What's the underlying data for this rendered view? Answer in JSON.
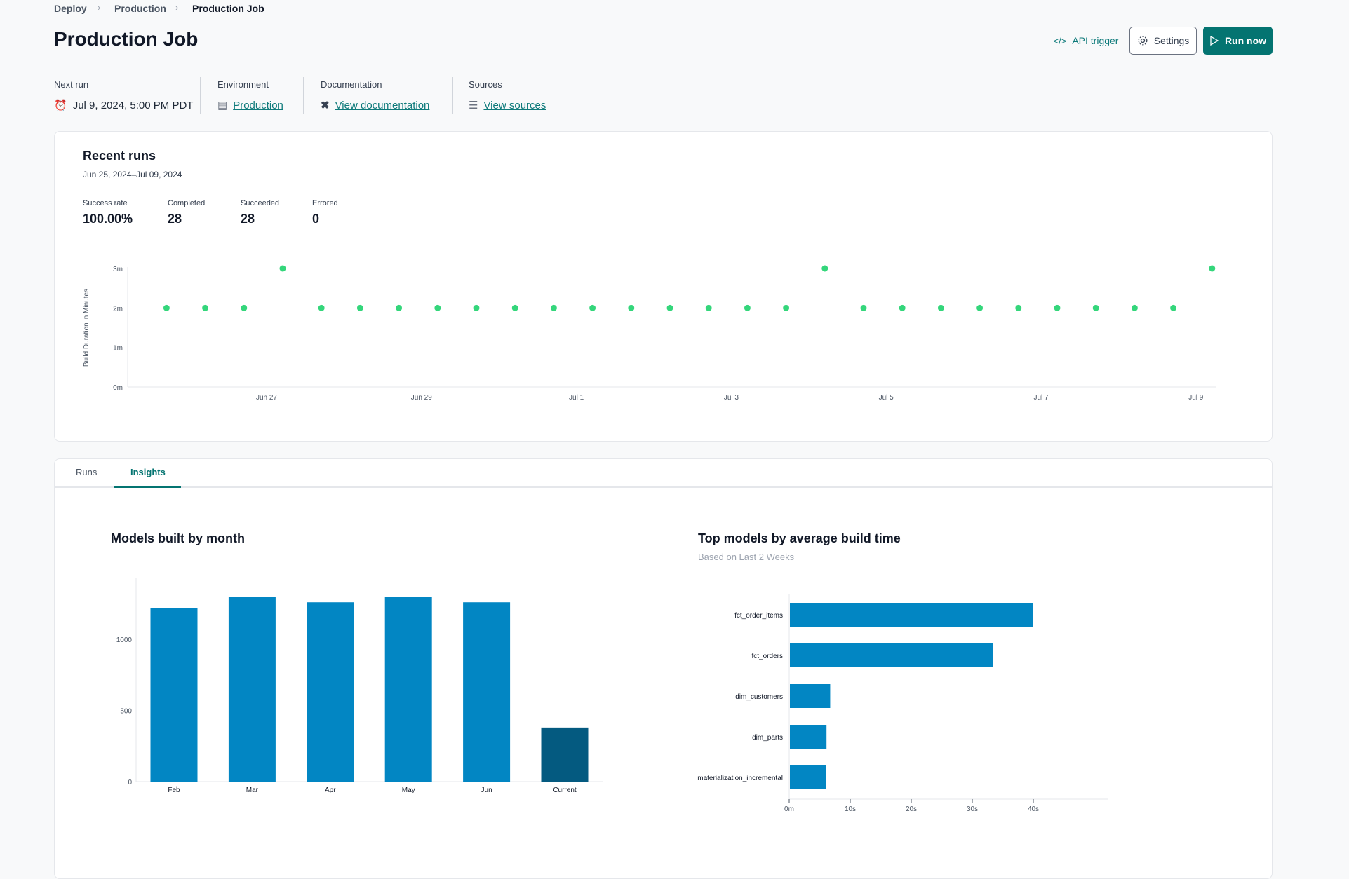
{
  "breadcrumb": [
    "Deploy",
    "Production",
    "Production Job"
  ],
  "header": {
    "title": "Production Job",
    "api_trigger": "API trigger",
    "settings": "Settings",
    "run_now": "Run now"
  },
  "meta": {
    "next_run": {
      "label": "Next run",
      "value": "Jul 9, 2024, 5:00 PM PDT"
    },
    "environment": {
      "label": "Environment",
      "value": "Production"
    },
    "documentation": {
      "label": "Documentation",
      "value": "View documentation"
    },
    "sources": {
      "label": "Sources",
      "value": "View sources"
    }
  },
  "recent_runs": {
    "title": "Recent runs",
    "range": "Jun 25, 2024–Jul 09, 2024",
    "stats": [
      {
        "label": "Success rate",
        "value": "100.00%"
      },
      {
        "label": "Completed",
        "value": "28"
      },
      {
        "label": "Succeeded",
        "value": "28"
      },
      {
        "label": "Errored",
        "value": "0"
      }
    ]
  },
  "tabs": [
    {
      "label": "Runs",
      "active": false
    },
    {
      "label": "Insights",
      "active": true
    }
  ],
  "colors": {
    "accent": "#047471",
    "success": "#34d67b",
    "bar": "#0286c3",
    "bar_current": "#045a80"
  },
  "chart_data": [
    {
      "type": "scatter",
      "ylabel": "Build Duration in Minutes",
      "yticks": [
        "0m",
        "1m",
        "2m",
        "3m"
      ],
      "ylim": [
        0,
        3
      ],
      "xticks": [
        "Jun 27",
        "Jun 29",
        "Jul 1",
        "Jul 3",
        "Jul 5",
        "Jul 7",
        "Jul 9"
      ],
      "x": [
        "2024-06-25T17:00",
        "2024-06-26T05:00",
        "2024-06-26T17:00",
        "2024-06-27T05:00",
        "2024-06-27T17:00",
        "2024-06-28T05:00",
        "2024-06-28T17:00",
        "2024-06-29T05:00",
        "2024-06-29T17:00",
        "2024-06-30T05:00",
        "2024-06-30T17:00",
        "2024-07-01T05:00",
        "2024-07-01T17:00",
        "2024-07-02T05:00",
        "2024-07-02T17:00",
        "2024-07-03T05:00",
        "2024-07-03T17:00",
        "2024-07-04T05:00",
        "2024-07-04T17:00",
        "2024-07-05T05:00",
        "2024-07-05T17:00",
        "2024-07-06T05:00",
        "2024-07-06T17:00",
        "2024-07-07T05:00",
        "2024-07-07T17:00",
        "2024-07-08T05:00",
        "2024-07-08T17:00",
        "2024-07-09T05:00"
      ],
      "y": [
        2,
        2,
        2,
        3,
        2,
        2,
        2,
        2,
        2,
        2,
        2,
        2,
        2,
        2,
        2,
        2,
        2,
        3,
        2,
        2,
        2,
        2,
        2,
        2,
        2,
        2,
        2,
        3
      ],
      "grid": false
    },
    {
      "type": "bar",
      "title": "Models built by month",
      "categories": [
        "Feb",
        "Mar",
        "Apr",
        "May",
        "Jun",
        "Current"
      ],
      "values": [
        1220,
        1300,
        1260,
        1300,
        1260,
        380
      ],
      "yticks": [
        "0",
        "500",
        "1000"
      ],
      "ylim": [
        0,
        1430
      ],
      "grid": false
    },
    {
      "type": "bar",
      "orientation": "horizontal",
      "title": "Top models by average build time",
      "subtitle": "Based on Last 2 Weeks",
      "categories": [
        "fct_order_items",
        "fct_orders",
        "dim_customers",
        "dim_parts",
        "materialization_incremental"
      ],
      "values": [
        39.8,
        33.3,
        6.6,
        6.0,
        5.9
      ],
      "xticks": [
        "0m",
        "10s",
        "20s",
        "30s",
        "40s"
      ],
      "xlim": [
        0,
        44
      ],
      "unit": "s",
      "grid": false
    }
  ]
}
